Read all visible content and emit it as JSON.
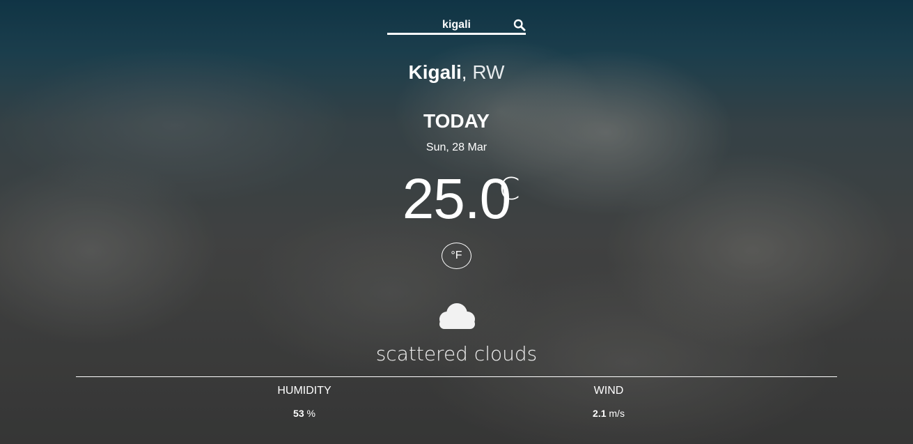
{
  "search": {
    "value": "kigali",
    "icon": "search-icon"
  },
  "location": {
    "city": "Kigali",
    "separator": ",",
    "country": "RW"
  },
  "day_label": "TODAY",
  "date": "Sun, 28 Mar",
  "temperature": {
    "value": "25.0",
    "unit": "C",
    "toggle_label": "°F"
  },
  "weather": {
    "icon": "cloud-icon",
    "description": "scattered clouds"
  },
  "stats": {
    "humidity": {
      "label": "HUMIDITY",
      "value": "53",
      "unit": "%"
    },
    "wind": {
      "label": "WIND",
      "value": "2.1",
      "unit": "m/s"
    }
  },
  "colors": {
    "text": "#ffffff",
    "sky_top": "#0f3a4c",
    "cloud": "#f2f2f2"
  }
}
